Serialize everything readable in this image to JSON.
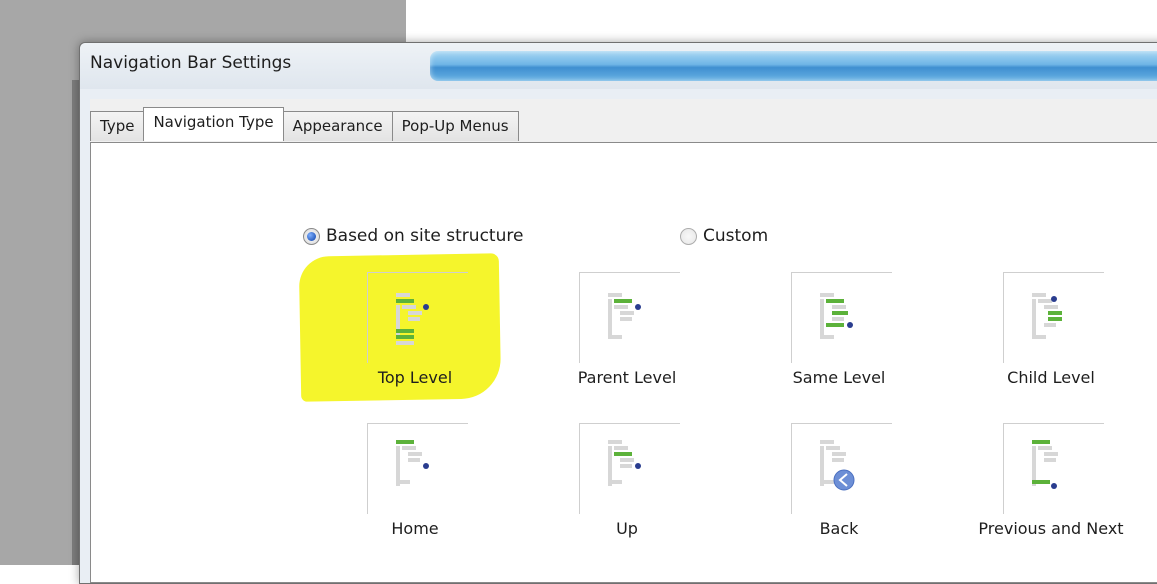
{
  "window": {
    "title": "Navigation Bar Settings"
  },
  "tabs": [
    {
      "label": "Type",
      "active": false
    },
    {
      "label": "Navigation Type",
      "active": true
    },
    {
      "label": "Appearance",
      "active": false
    },
    {
      "label": "Pop-Up Menus",
      "active": false
    }
  ],
  "radios": {
    "based_on_site_structure": {
      "label": "Based on site structure",
      "selected": true
    },
    "custom": {
      "label": "Custom",
      "selected": false
    }
  },
  "options": [
    {
      "label": "Top Level",
      "icon": "top-level-icon",
      "highlighted": true
    },
    {
      "label": "Parent Level",
      "icon": "parent-level-icon",
      "highlighted": false
    },
    {
      "label": "Same Level",
      "icon": "same-level-icon",
      "highlighted": false
    },
    {
      "label": "Child Level",
      "icon": "child-level-icon",
      "highlighted": false
    },
    {
      "label": "Home",
      "icon": "home-icon",
      "highlighted": false
    },
    {
      "label": "Up",
      "icon": "up-icon",
      "highlighted": false
    },
    {
      "label": "Back",
      "icon": "back-icon",
      "highlighted": false
    },
    {
      "label": "Previous and Next",
      "icon": "previous-next-icon",
      "highlighted": false
    }
  ],
  "colors": {
    "highlight": "#f5f52c",
    "node_green": "#5cb23a",
    "node_blue": "#2a3d8f",
    "title_glass": "#4a98d8"
  }
}
